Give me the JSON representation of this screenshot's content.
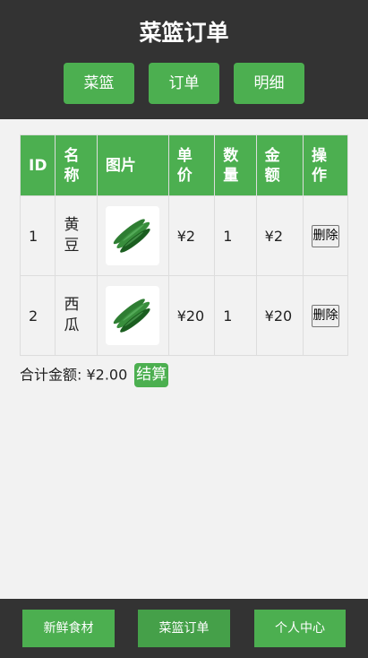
{
  "header": {
    "title": "菜篮订单",
    "nav": [
      "菜篮",
      "订单",
      "明细"
    ]
  },
  "table": {
    "columns": [
      "ID",
      "名称",
      "图片",
      "单价",
      "数量",
      "金额",
      "操作"
    ],
    "rows": [
      {
        "id": "1",
        "name": "黄豆",
        "image": "cucumber-image",
        "price": "¥2",
        "qty": "1",
        "amount": "¥2",
        "action": "删除"
      },
      {
        "id": "2",
        "name": "西瓜",
        "image": "cucumber-image",
        "price": "¥20",
        "qty": "1",
        "amount": "¥20",
        "action": "删除"
      }
    ]
  },
  "summary": {
    "total_text": "合计金额: ¥2.00",
    "checkout_label": "结算"
  },
  "footer": {
    "tabs": [
      "新鲜食材",
      "菜篮订单",
      "个人中心"
    ],
    "active_tab": "菜篮订单"
  },
  "colors": {
    "accent": "#4caf50",
    "dark_bar": "#333333",
    "background": "#f2f2f2"
  }
}
